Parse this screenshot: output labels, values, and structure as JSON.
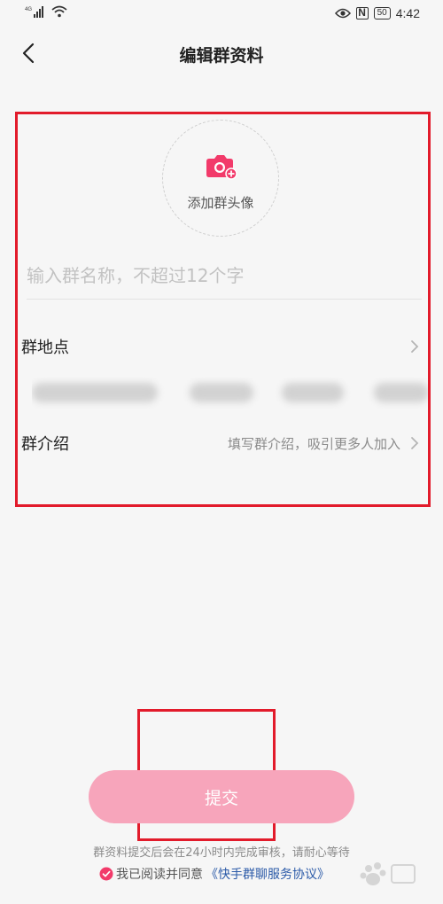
{
  "status_bar": {
    "network": "4G",
    "time": "4:42",
    "nfc": "N",
    "battery": "50"
  },
  "header": {
    "title": "编辑群资料"
  },
  "form": {
    "avatar_label": "添加群头像",
    "name_placeholder": "输入群名称，不超过12个字",
    "location_label": "群地点",
    "intro_label": "群介绍",
    "intro_placeholder": "填写群介绍，吸引更多人加入"
  },
  "footer": {
    "submit_label": "提交",
    "review_note": "群资料提交后会在24小时内完成审核，请耐心等待",
    "agreement_prefix": "我已阅读并同意",
    "agreement_link": "《快手群聊服务协议》"
  },
  "colors": {
    "accent": "#f7a5bb",
    "camera": "#f23a6a",
    "highlight_frame": "#e21b2b",
    "link": "#2b5aa8"
  }
}
